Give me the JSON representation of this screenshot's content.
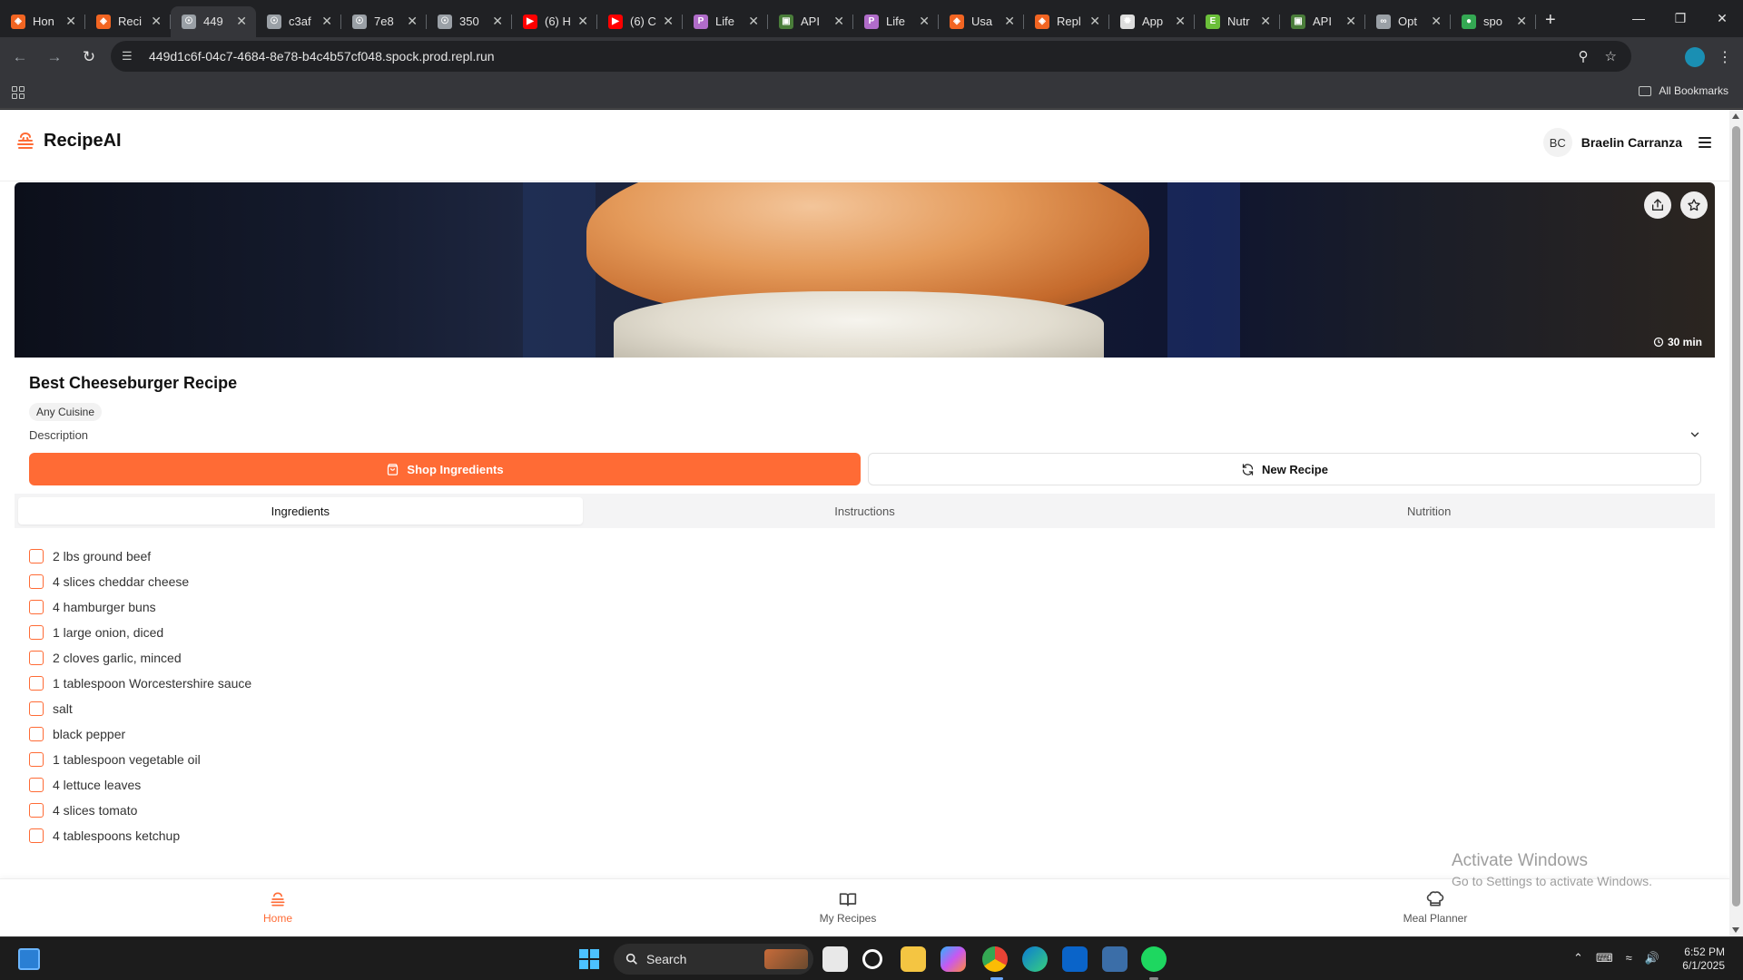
{
  "browser": {
    "tabs": [
      {
        "label": "Hon",
        "favicon_color": "#f26522",
        "favicon_glyph": "replit-icon",
        "active": false
      },
      {
        "label": "Reci",
        "favicon_color": "#f26522",
        "favicon_glyph": "replit-icon",
        "active": false
      },
      {
        "label": "449",
        "favicon_color": "#9aa0a6",
        "favicon_glyph": "globe-icon",
        "active": true
      },
      {
        "label": "c3af",
        "favicon_color": "#9aa0a6",
        "favicon_glyph": "globe-icon",
        "active": false
      },
      {
        "label": "7e8",
        "favicon_color": "#9aa0a6",
        "favicon_glyph": "globe-icon",
        "active": false
      },
      {
        "label": "350",
        "favicon_color": "#9aa0a6",
        "favicon_glyph": "globe-icon",
        "active": false
      },
      {
        "label": "(6) H",
        "favicon_color": "#ff0000",
        "favicon_glyph": "youtube-icon",
        "active": false
      },
      {
        "label": "(6) C",
        "favicon_color": "#ff0000",
        "favicon_glyph": "youtube-icon",
        "active": false
      },
      {
        "label": "Life",
        "favicon_color": "#b06cc9",
        "favicon_glyph": "p-icon",
        "active": false
      },
      {
        "label": "API",
        "favicon_color": "#4a7d3a",
        "favicon_glyph": "image-icon",
        "active": false
      },
      {
        "label": "Life",
        "favicon_color": "#b06cc9",
        "favicon_glyph": "p-icon",
        "active": false
      },
      {
        "label": "Usa",
        "favicon_color": "#f26522",
        "favicon_glyph": "replit-icon",
        "active": false
      },
      {
        "label": "Repl",
        "favicon_color": "#f26522",
        "favicon_glyph": "replit-icon",
        "active": false
      },
      {
        "label": "App",
        "favicon_color": "#dddddd",
        "favicon_glyph": "openai-icon",
        "active": false
      },
      {
        "label": "Nutr",
        "favicon_color": "#6bbf3a",
        "favicon_glyph": "e-icon",
        "active": false
      },
      {
        "label": "API",
        "favicon_color": "#4a7d3a",
        "favicon_glyph": "image-icon",
        "active": false
      },
      {
        "label": "Opt",
        "favicon_color": "#9aa0a6",
        "favicon_glyph": "link-icon",
        "active": false
      },
      {
        "label": "spo",
        "favicon_color": "#34a853",
        "favicon_glyph": "spock-icon",
        "active": false
      }
    ],
    "url": "449d1c6f-04c7-4684-8e78-b4c4b57cf048.spock.prod.repl.run",
    "bookmarks_label": "All Bookmarks"
  },
  "app": {
    "brand": "RecipeAI",
    "brand_color": "#ff6b35",
    "user_initials": "BC",
    "user_name": "Braelin Carranza"
  },
  "recipe": {
    "cook_time": "30 min",
    "title": "Best Cheeseburger Recipe",
    "cuisine": "Any Cuisine",
    "description_label": "Description",
    "shop_button": "Shop Ingredients",
    "new_button": "New Recipe",
    "tabs": [
      "Ingredients",
      "Instructions",
      "Nutrition"
    ],
    "active_tab": "Ingredients",
    "ingredients": [
      "2 lbs ground beef",
      "4 slices cheddar cheese",
      "4 hamburger buns",
      "1 large onion, diced",
      "2 cloves garlic, minced",
      "1 tablespoon Worcestershire sauce",
      "salt",
      "black pepper",
      "1 tablespoon vegetable oil",
      "4 lettuce leaves",
      "4 slices tomato",
      "4 tablespoons ketchup"
    ]
  },
  "bottom_nav": {
    "items": [
      "Home",
      "My Recipes",
      "Meal Planner"
    ],
    "active": "Home"
  },
  "watermark": {
    "line1": "Activate Windows",
    "line2": "Go to Settings to activate Windows."
  },
  "taskbar": {
    "search_label": "Search",
    "time": "6:52 PM",
    "date": "6/1/2025"
  }
}
